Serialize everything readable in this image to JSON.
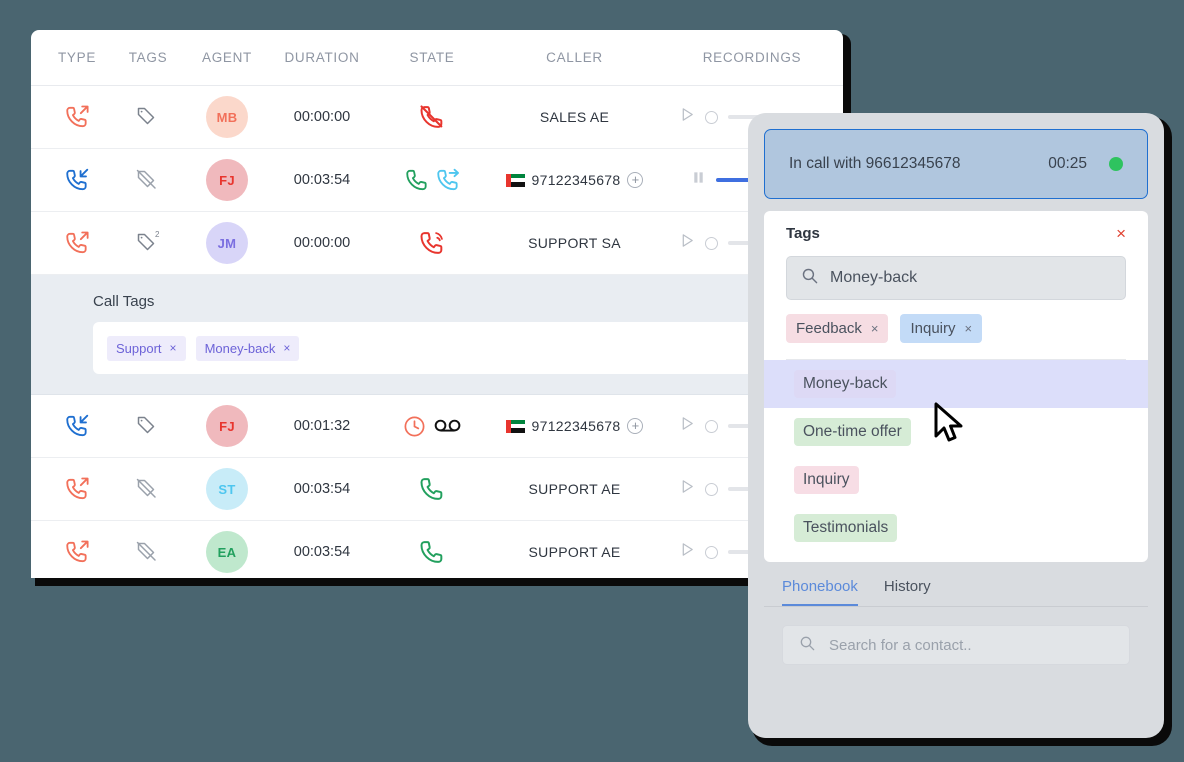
{
  "call_log": {
    "columns": [
      "TYPE",
      "TAGS",
      "AGENT",
      "DURATION",
      "STATE",
      "CALLER",
      "RECORDINGS"
    ],
    "rows": [
      {
        "direction": "outgoing",
        "tag_icon": "tag-icon",
        "tag_count": "",
        "agent": "MB",
        "duration": "00:00:00",
        "state": "missed-call-icon",
        "caller": "SALES AE",
        "caller_flag": "",
        "recording": "play",
        "progress": 0
      },
      {
        "direction": "incoming",
        "tag_icon": "tag-off-icon",
        "tag_count": "",
        "agent": "FJ",
        "duration": "00:03:54",
        "state": "in-call-transfer",
        "caller": "97122345678",
        "caller_flag": "ae",
        "recording": "pause",
        "progress": 100
      },
      {
        "direction": "outgoing",
        "tag_icon": "tag-icon",
        "tag_count": "2",
        "agent": "JM",
        "duration": "00:00:00",
        "state": "ringing-call-icon",
        "caller": "SUPPORT SA",
        "caller_flag": "",
        "recording": "play",
        "progress": 0
      },
      {
        "direction": "incoming",
        "tag_icon": "tag-icon",
        "tag_count": "",
        "agent": "FJ",
        "duration": "00:01:32",
        "state": "voicemail",
        "caller": "97122345678",
        "caller_flag": "ae",
        "recording": "play",
        "progress": 0
      },
      {
        "direction": "outgoing",
        "tag_icon": "tag-off-icon",
        "tag_count": "",
        "agent": "ST",
        "duration": "00:03:54",
        "state": "answered-call-icon",
        "caller": "SUPPORT AE",
        "caller_flag": "",
        "recording": "play",
        "progress": 0
      },
      {
        "direction": "outgoing",
        "tag_icon": "tag-off-icon",
        "tag_count": "",
        "agent": "EA",
        "duration": "00:03:54",
        "state": "answered-call-icon",
        "caller": "SUPPORT AE",
        "caller_flag": "",
        "recording": "play",
        "progress": 0
      }
    ],
    "call_tags_panel": {
      "title": "Call Tags",
      "chips": [
        {
          "label": "Support",
          "remove": "×"
        },
        {
          "label": "Money-back",
          "remove": "×"
        }
      ]
    }
  },
  "phone_widget": {
    "in_call": {
      "text": "In call with 96612345678",
      "timer": "00:25",
      "status_color": "#2ec35f"
    },
    "tags_card": {
      "title": "Tags",
      "close_label": "×",
      "search_value": "Money-back",
      "selected": [
        {
          "label": "Feedback",
          "remove": "×",
          "color": "#f6dde3"
        },
        {
          "label": "Inquiry",
          "remove": "×",
          "color": "#c3dbf7"
        }
      ],
      "options": [
        {
          "label": "Money-back",
          "color": "#ddd9f5",
          "highlighted": true
        },
        {
          "label": "One-time offer",
          "color": "#d6ecd6",
          "highlighted": false
        },
        {
          "label": "Inquiry",
          "color": "#f7dde5",
          "highlighted": false
        },
        {
          "label": "Testimonials",
          "color": "#d6ecd6",
          "highlighted": false
        }
      ]
    },
    "tabs": [
      {
        "label": "Phonebook",
        "active": true
      },
      {
        "label": "History",
        "active": false
      }
    ],
    "contact_search_placeholder": "Search for a contact.."
  },
  "theme": {
    "background": "#4a6570",
    "accent_blue": "#3f6fe0",
    "outgoing_red": "#f2705a",
    "incoming_blue": "#1f6fd0",
    "green": "#2ec35f"
  }
}
